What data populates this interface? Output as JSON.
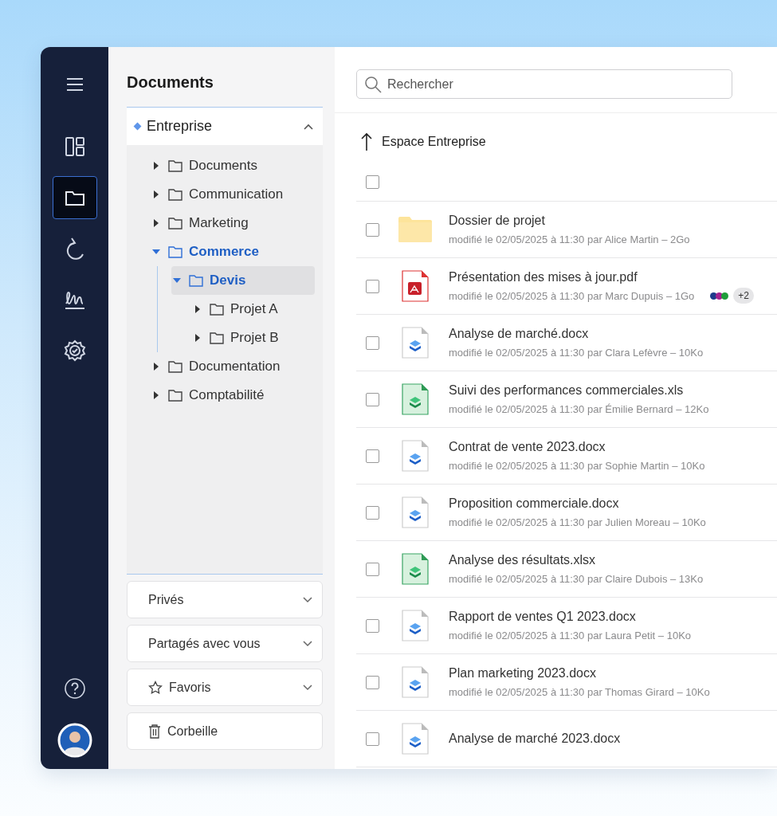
{
  "rail": {
    "items": [
      {
        "kind": "dashboard",
        "selected": false
      },
      {
        "kind": "folder",
        "selected": true
      },
      {
        "kind": "sync",
        "selected": false
      },
      {
        "kind": "signature",
        "selected": false
      },
      {
        "kind": "settings",
        "selected": false
      }
    ]
  },
  "sidebar": {
    "title": "Documents",
    "space": {
      "label": "Entreprise",
      "expanded": true
    },
    "tree": [
      {
        "label": "Documents",
        "expanded": false,
        "selected": false
      },
      {
        "label": "Communication",
        "expanded": false,
        "selected": false
      },
      {
        "label": "Marketing",
        "expanded": false,
        "selected": false
      },
      {
        "label": "Commerce",
        "expanded": true,
        "selected": false,
        "children": [
          {
            "label": "Devis",
            "expanded": true,
            "selected": true,
            "children": [
              {
                "label": "Projet A",
                "expanded": false,
                "selected": false
              },
              {
                "label": "Projet B",
                "expanded": false,
                "selected": false
              }
            ]
          }
        ]
      },
      {
        "label": "Documentation",
        "expanded": false,
        "selected": false
      },
      {
        "label": "Comptabilité",
        "expanded": false,
        "selected": false
      }
    ],
    "sections": [
      {
        "label": "Privés",
        "kind": "plain",
        "expanded": false
      },
      {
        "label": "Partagés avec vous",
        "kind": "plain",
        "expanded": false
      },
      {
        "label": "Favoris",
        "kind": "starred",
        "expanded": false
      },
      {
        "label": "Corbeille",
        "kind": "trash"
      }
    ]
  },
  "search": {
    "placeholder": "Rechercher"
  },
  "breadcrumb": {
    "label": "Espace Entreprise"
  },
  "select_all": {
    "checked": false
  },
  "files": [
    {
      "name": "Dossier de projet",
      "meta": "modifié le 02/05/2025 à 11:30 par Alice Martin – 2Go",
      "kind": "folder",
      "checked": false
    },
    {
      "name": "Présentation des mises à jour.pdf",
      "meta": "modifié le 02/05/2025 à 11:30 par Marc Dupuis – 1Go",
      "kind": "pdf",
      "checked": false,
      "collaborators": [
        {
          "color": "#1e3a8a"
        },
        {
          "color": "#a3208f"
        },
        {
          "color": "#1f9d3a"
        }
      ],
      "extra": "+2"
    },
    {
      "name": "Analyse de marché.docx",
      "meta": "modifié le 02/05/2025 à 11:30 par Clara Lefèvre – 10Ko",
      "kind": "doc",
      "checked": false
    },
    {
      "name": "Suivi des performances commerciales.xls",
      "meta": "modifié le 02/05/2025 à 11:30 par Émilie Bernard – 12Ko",
      "kind": "sheet",
      "checked": false
    },
    {
      "name": "Contrat de vente 2023.docx",
      "meta": "modifié le 02/05/2025 à 11:30 par Sophie Martin – 10Ko",
      "kind": "doc",
      "checked": false
    },
    {
      "name": "Proposition commerciale.docx",
      "meta": "modifié le 02/05/2025 à 11:30 par Julien Moreau – 10Ko",
      "kind": "doc",
      "checked": false
    },
    {
      "name": "Analyse des résultats.xlsx",
      "meta": "modifié le 02/05/2025 à 11:30 par Claire Dubois – 13Ko",
      "kind": "sheet",
      "checked": false
    },
    {
      "name": "Rapport de ventes Q1 2023.docx",
      "meta": "modifié le 02/05/2025 à 11:30 par Laura Petit – 10Ko",
      "kind": "doc",
      "checked": false
    },
    {
      "name": "Plan marketing 2023.docx",
      "meta": "modifié le 02/05/2025 à 11:30 par Thomas Girard – 10Ko",
      "kind": "doc",
      "checked": false
    },
    {
      "name": "Analyse de marché 2023.docx",
      "kind": "doc",
      "checked": false
    }
  ]
}
